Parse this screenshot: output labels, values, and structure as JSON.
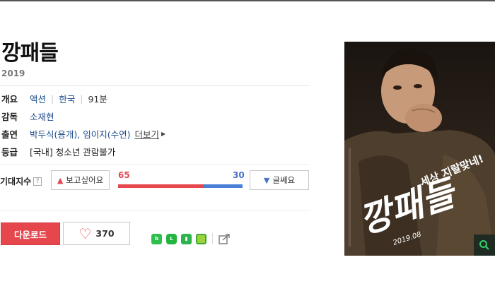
{
  "movie": {
    "title": "깡패들",
    "year": "2019"
  },
  "info": {
    "overview_label": "개요",
    "genre": "액션",
    "country": "한국",
    "runtime": "91분",
    "director_label": "감독",
    "director": "소재현",
    "cast_label": "출연",
    "cast": "박두식(용개), 임이지(수연)",
    "cast_more": "더보기",
    "rating_label": "등급",
    "rating": "[국내] 청소년 관람불가"
  },
  "expectation": {
    "label": "기대지수",
    "help": "?",
    "want_label": "보고싶어요",
    "notsure_label": "글쎄요",
    "want_count": 65,
    "notsure_count": 30,
    "want_fraction": 0.684
  },
  "actions": {
    "download_label": "다운로드",
    "like_count": "370"
  },
  "share": {
    "icons": [
      "band-icon",
      "line-icon",
      "bookmark-icon",
      "memo-icon",
      "share-out-icon"
    ]
  },
  "poster": {
    "tagline": "세상 지랄맞네!",
    "poster_title": "깡패들",
    "date": "2019.08"
  },
  "colors": {
    "accent_red": "#e5474d",
    "accent_blue": "#4a73c9",
    "link_blue": "#1a4a8a"
  }
}
